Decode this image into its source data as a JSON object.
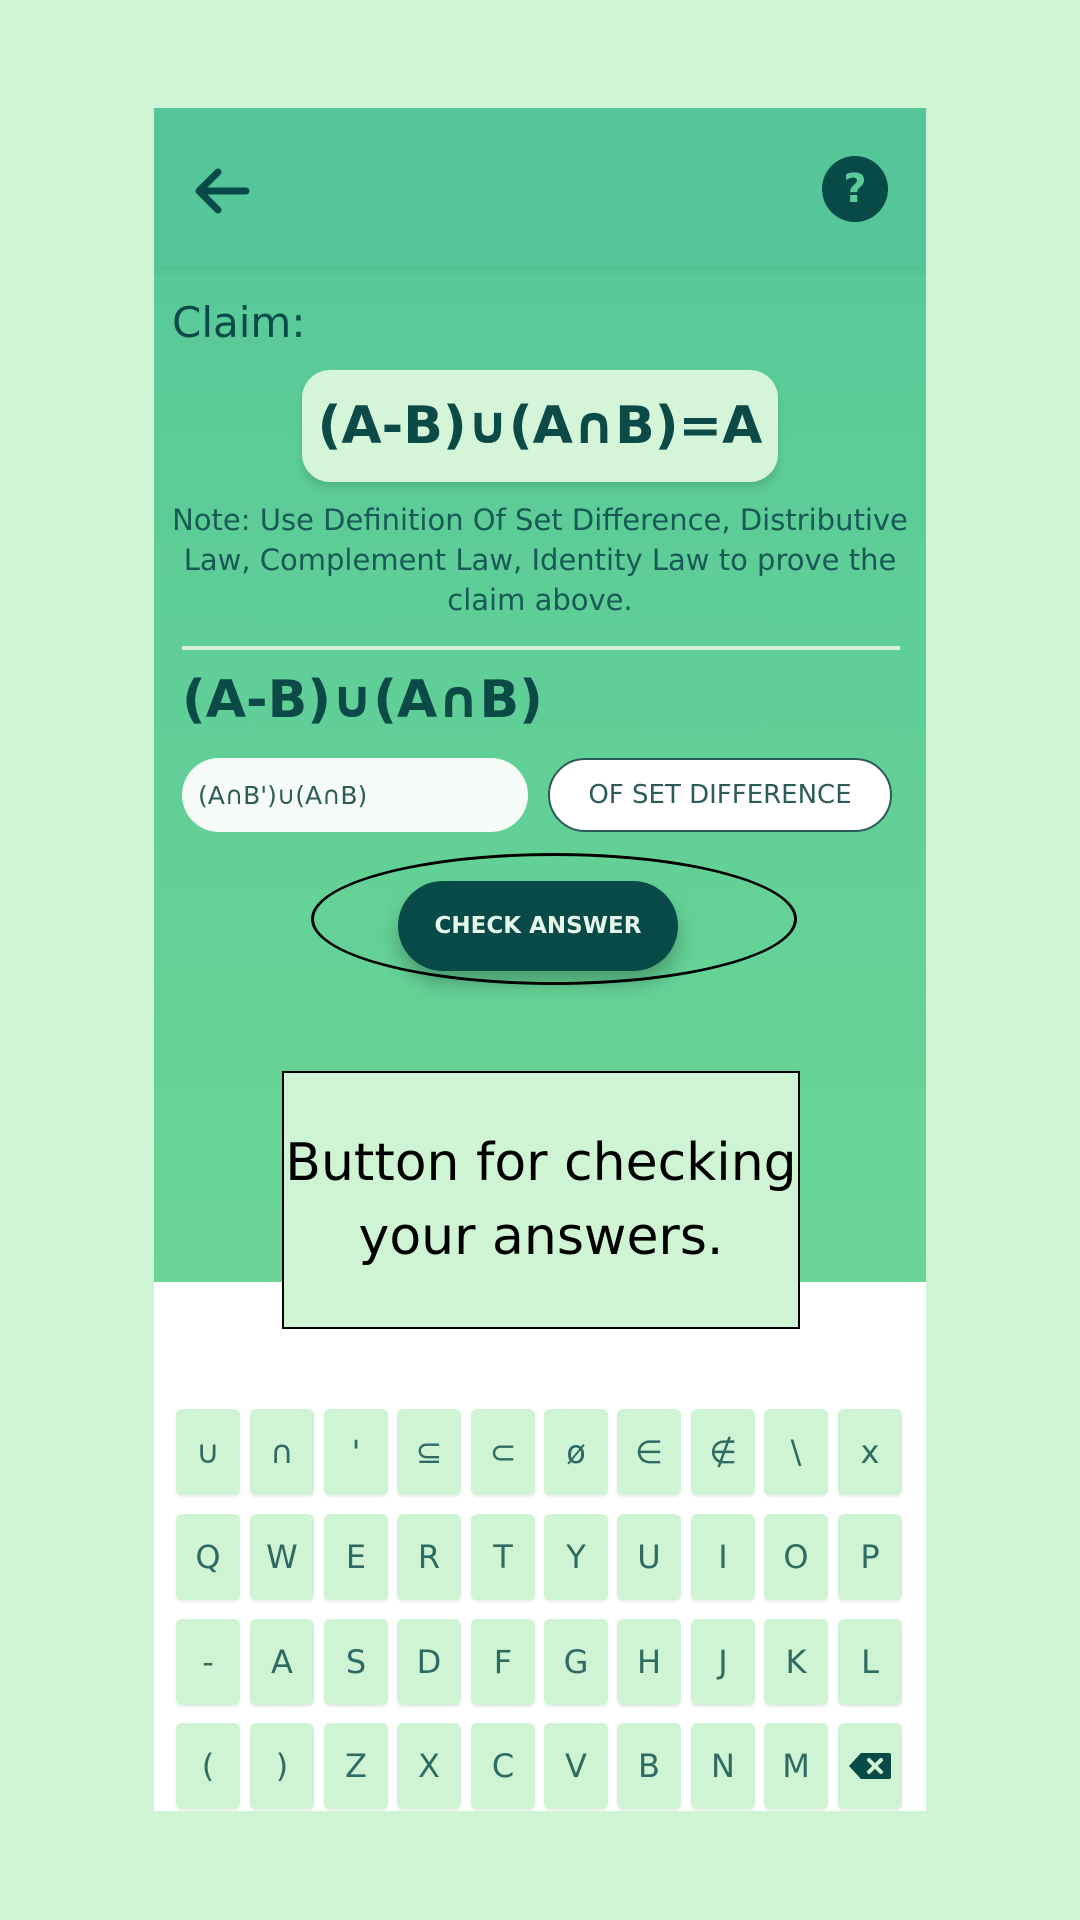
{
  "claim": {
    "label": "Claim:",
    "expression": "(A-B)∪(A∩B)=A",
    "note": "Note: Use Definition Of Set Difference, Distributive Law, Complement Law, Identity Law to prove the claim above."
  },
  "work": {
    "expression": "(A-B)∪(A∩B)",
    "answer_value": "(A∩B')∪(A∩B)",
    "rule_value": "OF SET DIFFERENCE"
  },
  "help_label": "?",
  "check_button": "CHECK ANSWER",
  "callout": "Button for checking your answers.",
  "keyboard": {
    "row1": [
      "∪",
      "∩",
      "'",
      "⊆",
      "⊂",
      "ø",
      "∈",
      "∉",
      "\\",
      "x"
    ],
    "row2": [
      "Q",
      "W",
      "E",
      "R",
      "T",
      "Y",
      "U",
      "I",
      "O",
      "P"
    ],
    "row3": [
      "-",
      "A",
      "S",
      "D",
      "F",
      "G",
      "H",
      "J",
      "K",
      "L"
    ],
    "row4": [
      "(",
      ")",
      "Z",
      "X",
      "C",
      "V",
      "B",
      "N",
      "M"
    ],
    "row5": [
      "=",
      "{",
      "}",
      "[",
      "]"
    ]
  },
  "colors": {
    "accent": "#074a48",
    "green": "#55c69a",
    "key": "#cff4d3"
  },
  "icons": {
    "back": "arrow-left-icon",
    "help": "question-icon",
    "backspace": "backspace-icon",
    "enter": "arrow-right-icon"
  }
}
